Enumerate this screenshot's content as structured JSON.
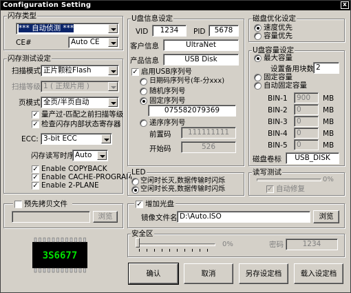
{
  "window": {
    "title": "Configuration Setting",
    "close_glyph": "x"
  },
  "flash_type": {
    "group_label": "闪存类型",
    "flash_select": "*** 自动侦测 ***",
    "ce_label": "CE#",
    "ce_select": "Auto CE"
  },
  "flash_test": {
    "group_label": "闪存测试设定",
    "scan_mode_label": "扫描模式",
    "scan_mode_value": "正片颗粒Flash",
    "scan_level_label": "扫描等级",
    "scan_level_value": "1 ( 正规片用 )",
    "page_mode_label": "页模式",
    "page_mode_value": "全页/半页自动",
    "cb_mass_produce": "量产过-匹配之前扫描等级",
    "cb_check_register": "检查闪存内部状态寄存器",
    "ecc_label": "ECC:",
    "ecc_value": "3-bit ECC",
    "timing_label": "闪存读写时序",
    "timing_value": "Auto",
    "cb_copyback": "Enable COPYBACK",
    "cb_cache": "Enable CACHE-PROGRAM",
    "cb_2plane": "Enable 2-PLANE"
  },
  "preset_copy": {
    "label": "预先拷贝文件",
    "browse": "浏览"
  },
  "usb_info": {
    "group_label": "U盘信息设定",
    "vid_label": "VID",
    "vid_value": "1234",
    "pid_label": "PID",
    "pid_value": "5678",
    "vendor_label": "客户信息",
    "vendor_value": "UltraNet",
    "product_label": "产品信息",
    "product_value": "USB Disk",
    "serial_enable": "启用USB序列号",
    "serial_date": "日期码序列号(年-分xxx)",
    "serial_random": "随机序列号",
    "serial_fixed": "固定序列号",
    "serial_fixed_value": "075582079369",
    "serial_increment": "递序序列号",
    "prefix_label": "前置码",
    "prefix_value": "111111111",
    "start_label": "开始码",
    "start_value": "526"
  },
  "led": {
    "group_label": "LED",
    "opt1": "空闲时长灭,数据传输时闪烁",
    "opt2": "空闲时长亮,数据传输时闪烁"
  },
  "cdrom": {
    "label": "增加光盘",
    "image_label": "镜像文件名",
    "image_value": "D:\\Auto.ISO",
    "browse": "浏览"
  },
  "disk_opt": {
    "group_label": "磁盘优化设定",
    "speed": "速度优先",
    "capacity": "容量优先"
  },
  "capacity": {
    "group_label": "U盘容量设定",
    "max": "最大容量",
    "reserve_label": "设置备用块数",
    "reserve_value": "2",
    "fixed": "固定容量",
    "auto_fixed": "自动固定容量",
    "bins": [
      {
        "label": "BIN-1",
        "value": "900",
        "unit": "MB"
      },
      {
        "label": "BIN-2",
        "value": "0",
        "unit": "MB"
      },
      {
        "label": "BIN-3",
        "value": "0",
        "unit": "MB"
      },
      {
        "label": "BIN-4",
        "value": "0",
        "unit": "MB"
      },
      {
        "label": "BIN-5",
        "value": "0",
        "unit": "MB"
      }
    ],
    "volume_label": "磁盘卷标",
    "volume_value": "USB_DISK"
  },
  "rw_test": {
    "group_label": "读写测试",
    "percent": "0%",
    "auto_repair": "自动修复"
  },
  "security": {
    "group_label": "安全区",
    "percent": "0%",
    "password_label": "密码",
    "password_value": "1234"
  },
  "chip": {
    "text": "3S6677",
    "pin_count": 12
  },
  "buttons": {
    "ok": "确认",
    "cancel": "取消",
    "save_as": "另存设定档",
    "load": "载入设定档"
  }
}
